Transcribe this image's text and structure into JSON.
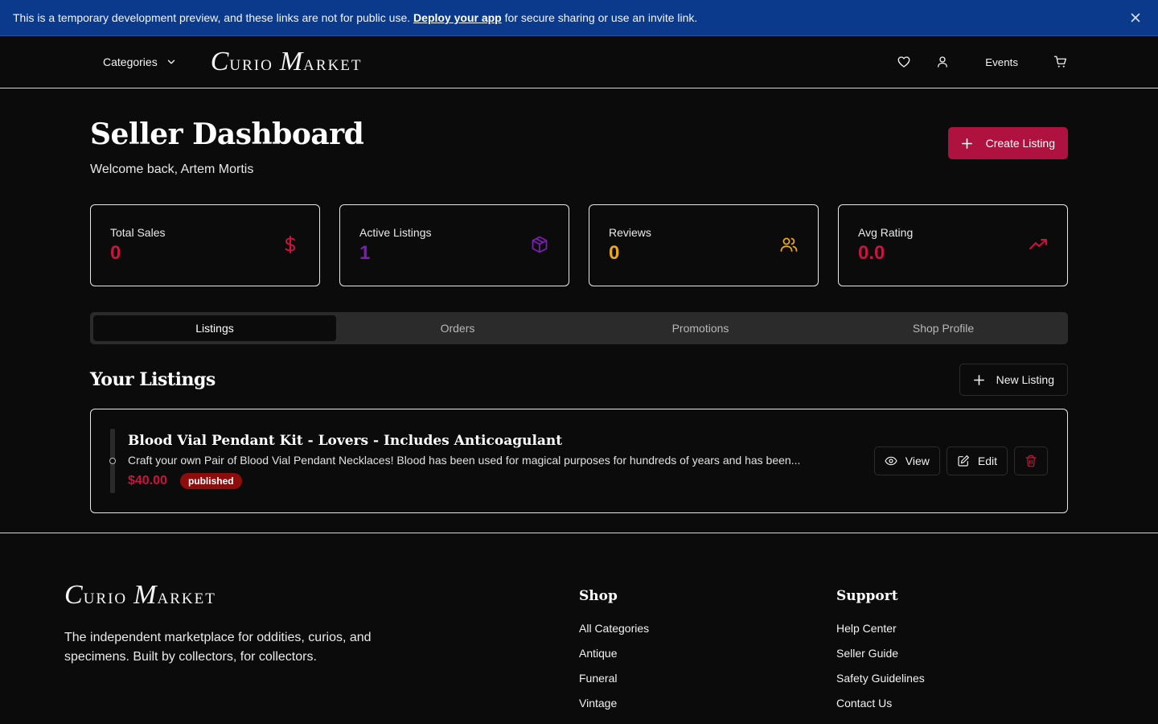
{
  "banner": {
    "text_before": "This is a temporary development preview, and these links are not for public use. ",
    "link": "Deploy your app",
    "text_after": " for secure sharing or use an invite link."
  },
  "nav": {
    "categories": "Categories",
    "logo_c": "C",
    "logo_urio": "URIO",
    "logo_m": "M",
    "logo_arket": "ARKET",
    "events": "Events"
  },
  "page": {
    "title": "Seller Dashboard",
    "welcome": "Welcome back, Artem Mortis",
    "create_label": "Create Listing"
  },
  "stats": [
    {
      "label": "Total Sales",
      "value": "0",
      "color": "#c8143f",
      "icon": "dollar-icon"
    },
    {
      "label": "Active Listings",
      "value": "1",
      "color": "#7a1fb0",
      "icon": "package-icon"
    },
    {
      "label": "Reviews",
      "value": "0",
      "color": "#e7a91a",
      "icon": "users-icon"
    },
    {
      "label": "Avg Rating",
      "value": "0.0",
      "color": "#c8143f",
      "icon": "trending-up-icon"
    }
  ],
  "tabs": [
    "Listings",
    "Orders",
    "Promotions",
    "Shop Profile"
  ],
  "listings_section": {
    "title": "Your Listings",
    "new_label": "New Listing"
  },
  "listing": {
    "title": "Blood Vial Pendant Kit - Lovers - Includes Anticoagulant",
    "description": "Craft your own Pair of Blood Vial Pendant Necklaces! Blood has been used for magical purposes for hundreds of years and has been...",
    "price": "$40.00",
    "status": "published",
    "view_label": "View",
    "edit_label": "Edit"
  },
  "footer": {
    "description": "The independent marketplace for oddities, curios, and specimens. Built by collectors, for collectors.",
    "shop_title": "Shop",
    "shop_links": [
      "All Categories",
      "Antique",
      "Funeral",
      "Vintage"
    ],
    "support_title": "Support",
    "support_links": [
      "Help Center",
      "Seller Guide",
      "Safety Guidelines",
      "Contact Us"
    ]
  },
  "colors": {
    "banner": "#0b3a8c",
    "accent": "#b0123f",
    "background": "#0b0b0b"
  }
}
